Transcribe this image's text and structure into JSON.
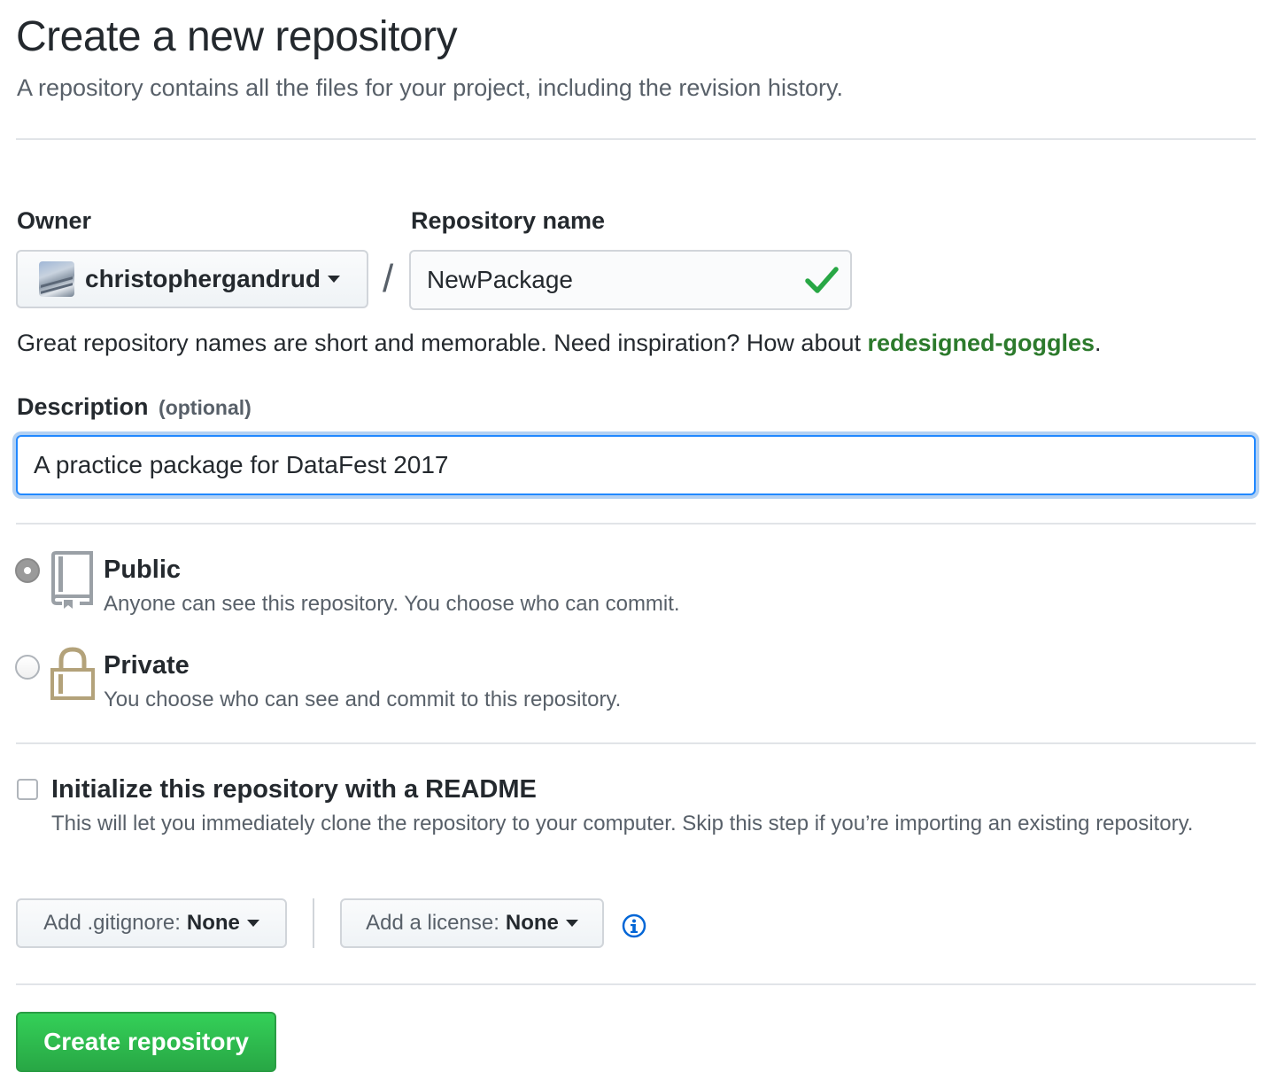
{
  "header": {
    "title": "Create a new repository",
    "subtitle": "A repository contains all the files for your project, including the revision history."
  },
  "owner": {
    "label": "Owner",
    "value": "christophergandrud"
  },
  "separator": "/",
  "repository": {
    "label": "Repository name",
    "value": "NewPackage",
    "valid": true
  },
  "hint": {
    "prefix": "Great repository names are short and memorable. Need inspiration? How about ",
    "suggestion": "redesigned-goggles",
    "suffix": "."
  },
  "description": {
    "label": "Description",
    "optional_label": "(optional)",
    "value": "A practice package for DataFest 2017"
  },
  "visibility": {
    "selected": "public",
    "public": {
      "title": "Public",
      "desc": "Anyone can see this repository. You choose who can commit."
    },
    "private": {
      "title": "Private",
      "desc": "You choose who can see and commit to this repository."
    }
  },
  "readme": {
    "title": "Initialize this repository with a README",
    "desc": "This will let you immediately clone the repository to your computer. Skip this step if you’re importing an existing repository.",
    "checked": false
  },
  "gitignore": {
    "label": "Add .gitignore:",
    "value": "None"
  },
  "license": {
    "label": "Add a license:",
    "value": "None"
  },
  "submit": {
    "label": "Create repository"
  },
  "colors": {
    "accent_green": "#28a745",
    "suggestion_green": "#2c7a2c",
    "focus_blue": "#2188ff",
    "info_blue": "#0366d6",
    "private_icon": "#b3a27a"
  },
  "icons": {
    "check": "check-icon",
    "repo": "repo-icon",
    "lock": "lock-icon",
    "info": "info-icon"
  }
}
